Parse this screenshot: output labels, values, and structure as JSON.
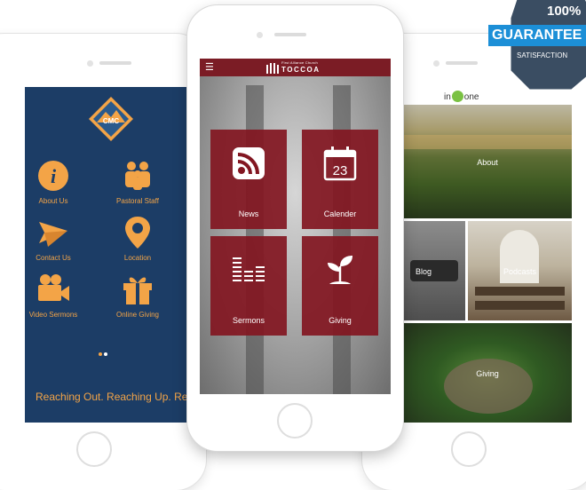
{
  "left_app": {
    "logo_text": "CMC",
    "items": [
      {
        "label": "About Us",
        "icon": "info-icon"
      },
      {
        "label": "Pastoral Staff",
        "icon": "people-icon"
      },
      {
        "label": "Contact Us",
        "icon": "paper-plane-icon"
      },
      {
        "label": "Location",
        "icon": "map-pin-icon"
      },
      {
        "label": "Video Sermons",
        "icon": "video-camera-icon"
      },
      {
        "label": "Online Giving",
        "icon": "gift-icon"
      }
    ],
    "tagline": "Reaching Out. Reaching Up. Reaching In.",
    "accent": "#f3a447",
    "background": "#1c3d66"
  },
  "middle_app": {
    "church_small": "First Alliance Church",
    "church_name": "TOCCOA",
    "calendar_day": "23",
    "tiles": [
      {
        "label": "News",
        "icon": "rss-icon"
      },
      {
        "label": "Calender",
        "icon": "calendar-icon"
      },
      {
        "label": "Sermons",
        "icon": "equalizer-icon"
      },
      {
        "label": "Giving",
        "icon": "plant-icon"
      }
    ],
    "brand_color": "#7b1c25"
  },
  "right_app": {
    "logo_left": "in",
    "logo_right": "one",
    "panels": [
      {
        "label": "About"
      },
      {
        "label": "Blog"
      },
      {
        "label": "Podcasts"
      },
      {
        "label": "Giving"
      }
    ],
    "logo_dot_color": "#7ac143"
  },
  "badge": {
    "top": "100%",
    "middle": "GUARANTEE",
    "bottom": "SATISFACTION",
    "ribbon_color": "#1c8fd7",
    "seal_color": "#3a4d62"
  }
}
